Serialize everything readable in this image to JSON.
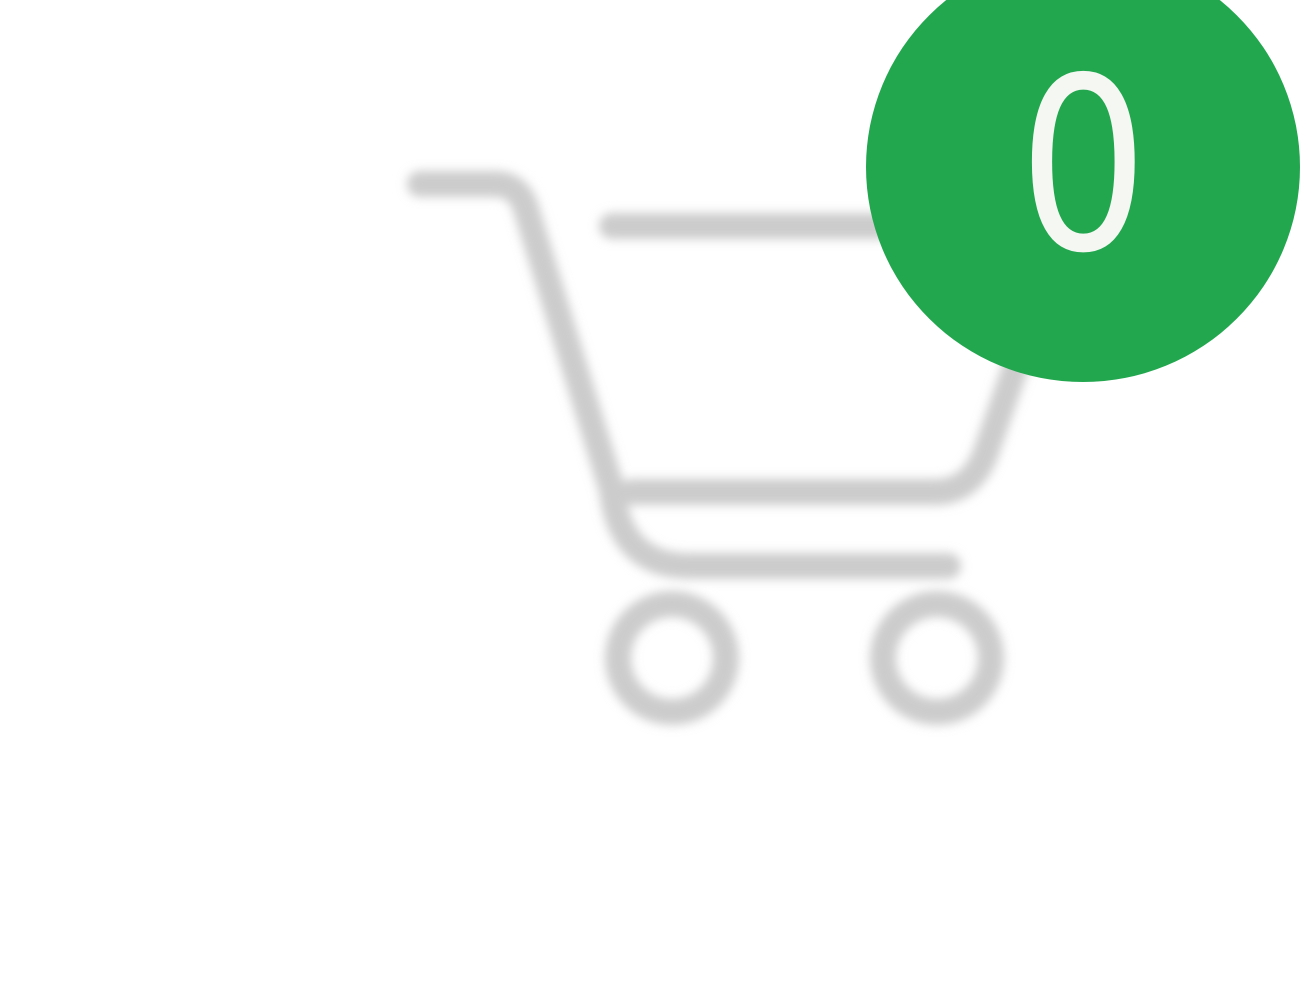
{
  "cart": {
    "icon": "shopping-cart-icon",
    "icon_color": "#cccccc",
    "badge": {
      "count": "0",
      "background_color": "#22a74f",
      "text_color": "#f4f7f2"
    }
  }
}
